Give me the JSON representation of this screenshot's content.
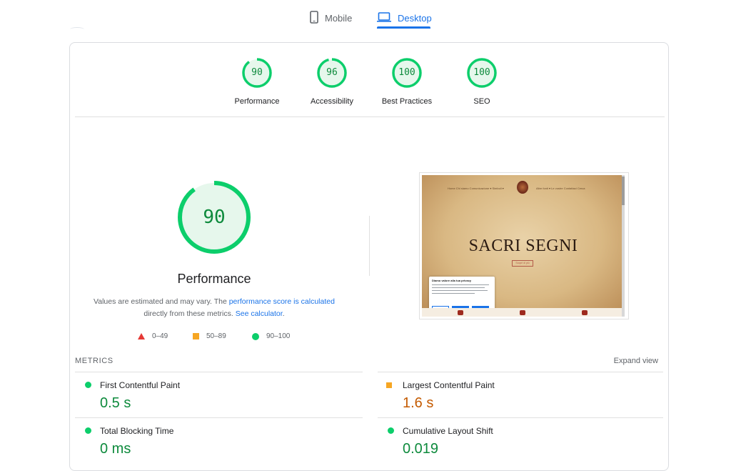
{
  "tabs": {
    "mobile": "Mobile",
    "desktop": "Desktop"
  },
  "colors": {
    "pass": "#0cce6b",
    "average": "#f6a623",
    "fail": "#e53935",
    "accent": "#1a73e8"
  },
  "categories": [
    {
      "label": "Performance",
      "score": "90"
    },
    {
      "label": "Accessibility",
      "score": "96"
    },
    {
      "label": "Best Practices",
      "score": "100"
    },
    {
      "label": "SEO",
      "score": "100"
    }
  ],
  "performance": {
    "score": "90",
    "title": "Performance",
    "note_prefix": "Values are estimated and may vary. The ",
    "note_link1": "performance score is calculated",
    "note_middle": " directly from these metrics. ",
    "note_link2": "See calculator",
    "note_suffix": "."
  },
  "legend": {
    "fail": "0–49",
    "average": "50–89",
    "pass": "90–100"
  },
  "preview": {
    "hero_text": "SACRI SEGNI",
    "button_text": "Scopri di più",
    "cookie_title": "Diamo valore alla tua privacy",
    "nav_left": "Home   Chi siamo   Comunicazione ▾   Simboli ▾",
    "nav_right": "Altre fonti ▾   Le vostre   Contattaci   Cerca"
  },
  "metrics": {
    "title": "METRICS",
    "expand": "Expand view",
    "items": [
      {
        "name": "First Contentful Paint",
        "value": "0.5 s",
        "rating": "pass"
      },
      {
        "name": "Largest Contentful Paint",
        "value": "1.6 s",
        "rating": "average"
      },
      {
        "name": "Total Blocking Time",
        "value": "0 ms",
        "rating": "pass"
      },
      {
        "name": "Cumulative Layout Shift",
        "value": "0.019",
        "rating": "pass"
      }
    ]
  }
}
